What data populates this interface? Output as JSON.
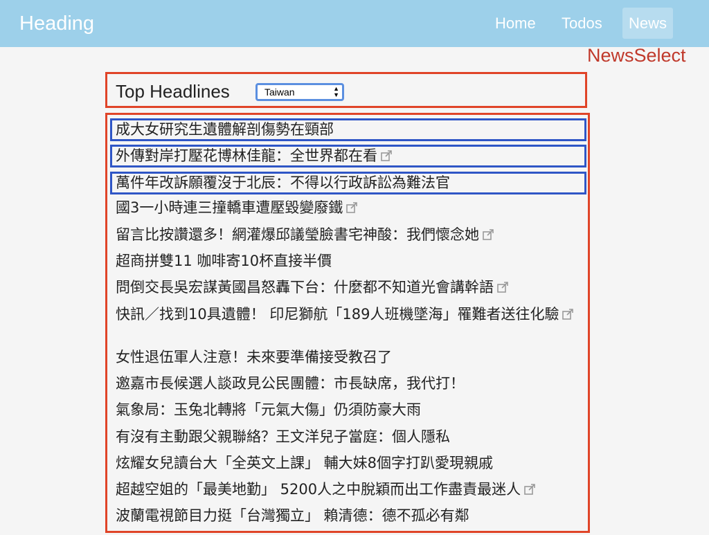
{
  "navbar": {
    "brand": "Heading",
    "links": [
      "Home",
      "Todos",
      "News"
    ]
  },
  "annotation": "NewsSelect",
  "headlines": {
    "title": "Top Headlines",
    "country": "Taiwan"
  },
  "items": [
    {
      "text": "成大女研究生遺體解剖傷勢在頸部",
      "external": false
    },
    {
      "text": "外傳對岸打壓花博林佳龍：全世界都在看",
      "external": true
    },
    {
      "text": "萬件年改訴願覆沒于北辰：不得以行政訴訟為難法官",
      "external": false
    },
    {
      "text": "國3一小時連三撞轎車遭壓毀變廢鐵",
      "external": true
    },
    {
      "text": "留言比按讚還多！網灌爆邱議瑩臉書宅神酸：我們懷念她",
      "external": true
    },
    {
      "text": "超商拼雙11 咖啡寄10杯直接半價",
      "external": false
    },
    {
      "text": "問倒交長吳宏謀黃國昌怒轟下台：什麼都不知道光會講幹語",
      "external": true
    },
    {
      "text": "快訊／找到10具遺體！ 印尼獅航「189人班機墜海」罹難者送往化驗",
      "external": true
    },
    {
      "text": "女性退伍軍人注意！未來要準備接受教召了",
      "external": false
    },
    {
      "text": "邀嘉市長候選人談政見公民團體：市長缺席，我代打！",
      "external": false
    },
    {
      "text": "氣象局：玉兔北轉將「元氣大傷」仍須防豪大雨",
      "external": false
    },
    {
      "text": "有沒有主動跟父親聯絡？王文洋兒子當庭：個人隱私",
      "external": false
    },
    {
      "text": "炫耀女兒讀台大「全英文上課」 輔大妹8個字打趴愛現親戚",
      "external": false
    },
    {
      "text": "超越空姐的「最美地勤」 5200人之中脫穎而出工作盡責最迷人",
      "external": true
    },
    {
      "text": "波蘭電視節目力挺「台灣獨立」 賴清德：德不孤必有鄰",
      "external": false
    }
  ]
}
